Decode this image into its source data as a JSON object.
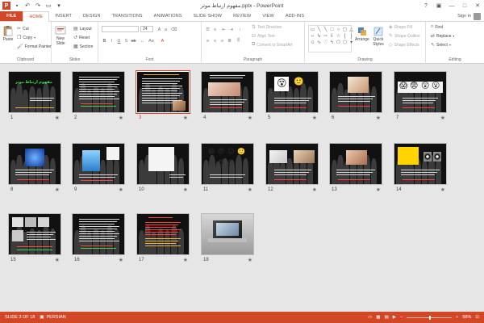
{
  "window": {
    "title": "مفهوم ارتباط موثر.pptx - PowerPoint",
    "help_icon": "?",
    "minimize_icon": "—",
    "maximize_icon": "□",
    "close_icon": "✕",
    "ribbon_options_icon": "▣"
  },
  "quick_access": {
    "app_icon": "P",
    "save_icon": "▪",
    "undo_icon": "↶",
    "redo_icon": "↷",
    "present_icon": "▭",
    "customize_icon": "▾"
  },
  "tabs": [
    "FILE",
    "HOME",
    "INSERT",
    "DESIGN",
    "TRANSITIONS",
    "ANIMATIONS",
    "SLIDE SHOW",
    "REVIEW",
    "VIEW",
    "ADD-INS"
  ],
  "active_tab": "HOME",
  "account": {
    "sign_in": "Sign in"
  },
  "ribbon": {
    "clipboard": {
      "label": "Clipboard",
      "paste": "Paste",
      "cut": "Cut",
      "copy": "Copy",
      "format_painter": "Format Painter"
    },
    "slides": {
      "label": "Slides",
      "new_slide_line1": "New",
      "new_slide_line2": "Slide",
      "layout": "Layout",
      "reset": "Reset",
      "section": "Section"
    },
    "font": {
      "label": "Font",
      "font_name": "",
      "font_size": "24"
    },
    "paragraph": {
      "label": "Paragraph",
      "text_direction": "Text Direction",
      "align_text": "Align Text",
      "convert_smartart": "Convert to SmartArt"
    },
    "drawing": {
      "label": "Drawing",
      "arrange": "Arrange",
      "quick_styles_line1": "Quick",
      "quick_styles_line2": "Styles",
      "shape_fill": "Shape Fill",
      "shape_outline": "Shape Outline",
      "shape_effects": "Shape Effects"
    },
    "editing": {
      "label": "Editing",
      "find": "Find",
      "replace": "Replace",
      "select": "Select"
    }
  },
  "slides": [
    {
      "number": "1",
      "selected": false,
      "style": "title"
    },
    {
      "number": "2",
      "selected": false,
      "style": "text"
    },
    {
      "number": "3",
      "selected": true,
      "style": "text-photo"
    },
    {
      "number": "4",
      "selected": false,
      "style": "photo-wide"
    },
    {
      "number": "5",
      "selected": false,
      "style": "emoji-yellow"
    },
    {
      "number": "6",
      "selected": false,
      "style": "photo-kid"
    },
    {
      "number": "7",
      "selected": false,
      "style": "faces"
    },
    {
      "number": "8",
      "selected": false,
      "style": "blue-head"
    },
    {
      "number": "9",
      "selected": false,
      "style": "blue-figure"
    },
    {
      "number": "10",
      "selected": false,
      "style": "white-box"
    },
    {
      "number": "11",
      "selected": false,
      "style": "emoji-row"
    },
    {
      "number": "12",
      "selected": false,
      "style": "handshake"
    },
    {
      "number": "13",
      "selected": false,
      "style": "photo-people"
    },
    {
      "number": "14",
      "selected": false,
      "style": "yellow-panel"
    },
    {
      "number": "15",
      "selected": false,
      "style": "photo-collage"
    },
    {
      "number": "16",
      "selected": false,
      "style": "text"
    },
    {
      "number": "17",
      "selected": false,
      "style": "red-text"
    },
    {
      "number": "18",
      "selected": false,
      "style": "laptop"
    }
  ],
  "slide1_title": "مفهوم ارتباط موثر",
  "status": {
    "slide_info": "SLIDE 3 OF 18",
    "language": "PERSIAN",
    "zoom": "68%",
    "zoom_minus": "−",
    "zoom_plus": "+"
  },
  "colors": {
    "accent": "#d24726",
    "selected_border": "#d24726"
  }
}
